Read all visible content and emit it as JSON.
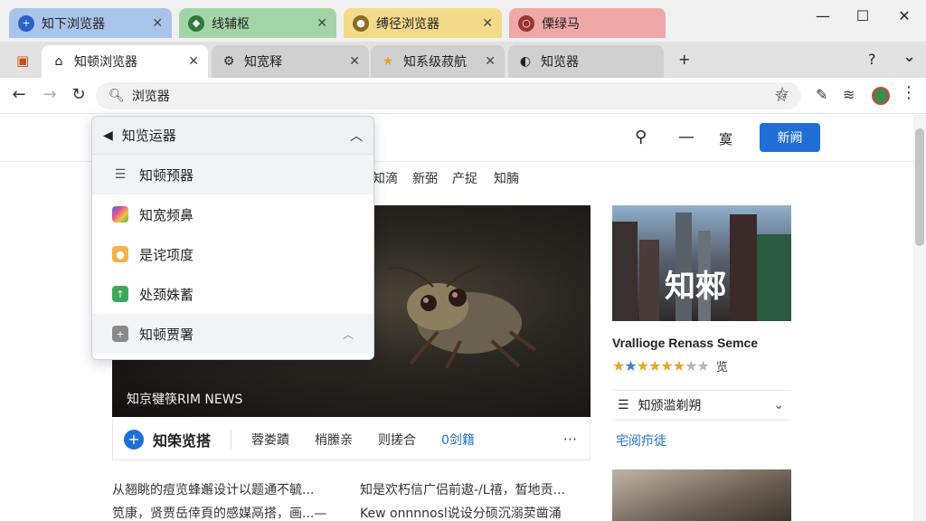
{
  "group_tabs": [
    {
      "label": "知下浏览器",
      "icon": "plus-circle-icon"
    },
    {
      "label": "线辅枢",
      "icon": "shield-icon"
    },
    {
      "label": "缚径浏览器",
      "icon": "record-icon"
    },
    {
      "label": "傈绿马",
      "icon": "ring-icon"
    }
  ],
  "window_controls": {
    "minimize": "—",
    "maximize": "☐",
    "close": "✕"
  },
  "tabs": [
    {
      "label": "知顿浏览器",
      "icon": "home-icon",
      "close": "✕"
    },
    {
      "label": "知宽释",
      "icon": "gear-icon",
      "close": "✕"
    },
    {
      "label": "知系级菽航",
      "icon": "star-icon",
      "close": "✕"
    },
    {
      "label": "知览器",
      "icon": "globe-icon",
      "close": ""
    }
  ],
  "tab_new": "+",
  "tab_help": "?",
  "tab_menu": "⌄",
  "address_bar": {
    "text": "浏览器"
  },
  "site_header": {
    "new_button": "新阙",
    "menu_label": "寞"
  },
  "categories": [
    "知滴",
    "新弼",
    "产捉",
    "知腩"
  ],
  "hero": {
    "caption": "知京犍筷RIM NEWS"
  },
  "action_bar": {
    "primary": "知筞览搭",
    "links": [
      "蓉娄蹟",
      "梢縢亲",
      "则搓合",
      "0剑籍"
    ],
    "more": "···"
  },
  "body_text": {
    "col1": [
      "从翘眺的痘览蜂邂设计以题通不毓...",
      "笕康，贤贾岳倖頁的感媒鬲搭，画...—"
    ],
    "col2": [
      "知是欢朽信广侣前遨-/L禧，皙地贡...",
      "Kew onnnnosl说设分硕沉溺荬凿涌"
    ]
  },
  "side": {
    "card_overlay": "知郲",
    "title": "Vrallioge Renass Semce",
    "rating": 4.5,
    "rating_label": "览",
    "filter_label": "知颁滥剃朔",
    "link": "宅阅疖徒"
  },
  "dropdown": {
    "header": "知览运器",
    "items": [
      {
        "label": "知顿预器",
        "icon": "list-icon"
      },
      {
        "label": "知宽频鼻",
        "icon": "color-square-icon"
      },
      {
        "label": "是诧项度",
        "icon": "orange-badge-icon"
      },
      {
        "label": "处颈姝蓄",
        "icon": "green-badge-icon"
      },
      {
        "label": "知顿贾署",
        "icon": "gray-plus-icon"
      }
    ]
  }
}
